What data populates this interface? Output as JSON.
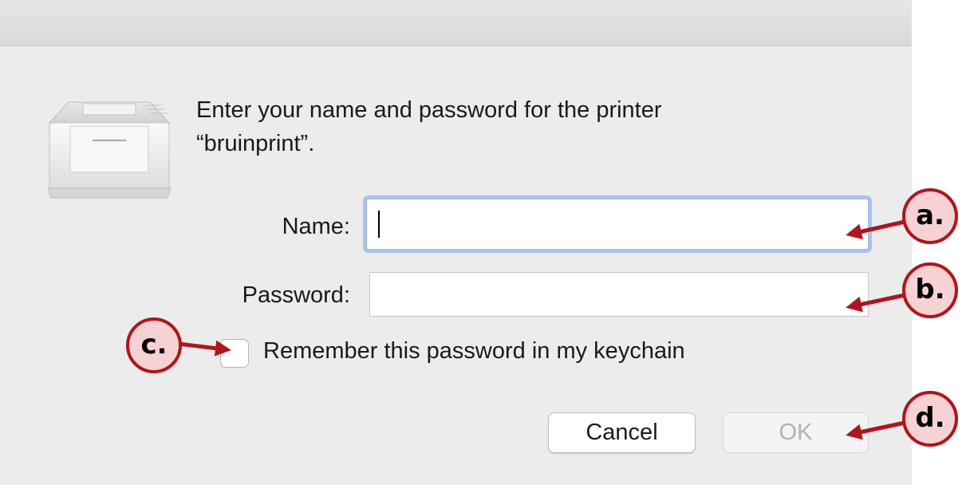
{
  "dialog": {
    "message_line1": "Enter your name and password for the printer",
    "message_line2": "“bruinprint”."
  },
  "form": {
    "name_label": "Name:",
    "name_value": "",
    "password_label": "Password:",
    "password_value": "",
    "remember_label": "Remember this password in my keychain",
    "remember_checked": false
  },
  "buttons": {
    "cancel_label": "Cancel",
    "ok_label": "OK",
    "ok_enabled": false
  },
  "annotations": {
    "a_label": "a.",
    "b_label": "b.",
    "c_label": "c.",
    "d_label": "d.",
    "color": "#b3131b",
    "fill": "#f6d2d2"
  },
  "icons": {
    "printer": "printer-icon"
  },
  "colors": {
    "focus_ring": "#a7c3ee",
    "dialog_bg": "#ececec"
  }
}
